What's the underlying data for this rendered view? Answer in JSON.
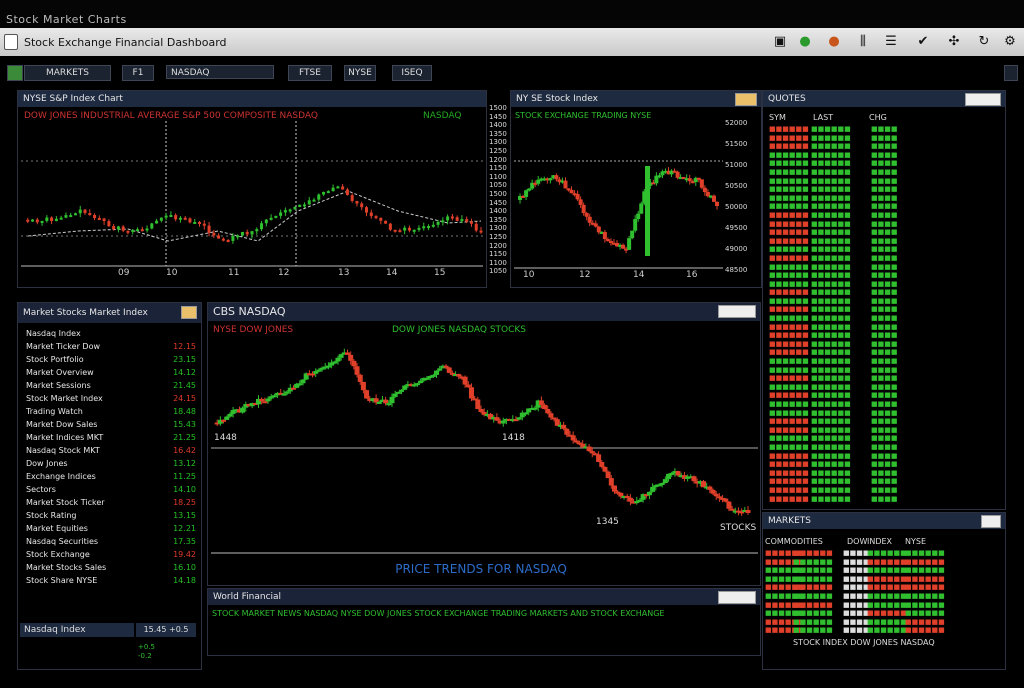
{
  "window": {
    "title": "Stock Market Charts"
  },
  "header": {
    "title": "Stock Exchange Financial Dashboard",
    "icons": [
      "monitor-icon",
      "green-globe-icon",
      "orange-globe-icon",
      "bars-icon",
      "list-icon",
      "check-icon",
      "network-icon",
      "refresh-icon",
      "settings-icon"
    ]
  },
  "toolbar": {
    "items": [
      "MARKETS",
      "F1",
      "NASDAQ",
      "FTSE",
      "NYSE",
      "ISEQ"
    ]
  },
  "panels": {
    "top_left": {
      "title": "NYSE S&P Index Chart",
      "ticker": "DOW JONES INDUSTRIAL AVERAGE  S&P 500 COMPOSITE  NASDAQ",
      "ticker2": "NASDAQ",
      "x_labels": [
        "09",
        "10",
        "11",
        "12",
        "13",
        "14",
        "15"
      ],
      "y_labels": [
        "1500",
        "1450",
        "1400",
        "1350",
        "1300",
        "1250",
        "1200",
        "1150",
        "1100",
        "1050"
      ]
    },
    "top_mid": {
      "title": "NY SE Stock Index",
      "ticker": "STOCK EXCHANGE TRADING NYSE",
      "x_labels": [
        "10",
        "12",
        "14",
        "16"
      ],
      "y_labels": [
        "52000",
        "51500",
        "51000",
        "50500",
        "50000",
        "49500",
        "49000",
        "48500"
      ]
    },
    "right_quotes": {
      "title": "QUOTES",
      "headers": [
        "SYM",
        "LAST",
        "CHG"
      ]
    },
    "watchlist": {
      "title": "Market Stocks Market Index",
      "rows": [
        {
          "name": "Nasdaq Index",
          "val": ""
        },
        {
          "name": "Market Ticker Dow",
          "val": "12.15"
        },
        {
          "name": "Stock Portfolio",
          "val": "23.15"
        },
        {
          "name": "Market Overview",
          "val": "14.12"
        },
        {
          "name": "Market Sessions",
          "val": "21.45"
        },
        {
          "name": "Stock Market Index",
          "val": "24.15"
        },
        {
          "name": "Trading Watch",
          "val": "18.48"
        },
        {
          "name": "Market Dow Sales",
          "val": "15.43"
        },
        {
          "name": "Market Indices MKT",
          "val": "21.25"
        },
        {
          "name": "Nasdaq Stock MKT",
          "val": "16.42"
        },
        {
          "name": "Dow Jones",
          "val": "13.12"
        },
        {
          "name": "Exchange Indices",
          "val": "11.25"
        },
        {
          "name": "Sectors",
          "val": "14.10"
        },
        {
          "name": "Market Stock Ticker",
          "val": "18.25"
        },
        {
          "name": "Stock Rating",
          "val": "13.15"
        },
        {
          "name": "Market Equities",
          "val": "12.21"
        },
        {
          "name": "Nasdaq Securities",
          "val": "17.35"
        },
        {
          "name": "Stock Exchange",
          "val": "19.42"
        },
        {
          "name": "Market Stocks Sales",
          "val": "16.10"
        },
        {
          "name": "Stock Share NYSE",
          "val": "14.18"
        }
      ],
      "footer_left": "Nasdaq Index",
      "footer_right": "15.45 +0.5"
    },
    "main_chart": {
      "title": "CBS NASDAQ",
      "ticker_left": "NYSE DOW JONES",
      "ticker_right": "DOW JONES NASDAQ STOCKS",
      "label_1": "1448",
      "label_2": "1418",
      "label_3": "1345",
      "label_4": "STOCKS",
      "footer": "PRICE TRENDS FOR NASDAQ"
    },
    "news": {
      "title": "World Financial",
      "ticker": "STOCK MARKET NEWS NASDAQ NYSE DOW JONES STOCK EXCHANGE TRADING MARKETS AND STOCK EXCHANGE"
    },
    "bottom_right": {
      "title": "MARKETS",
      "headers": [
        "COMMODITIES",
        "DOW",
        "INDEX",
        "NYSE"
      ],
      "footer": "STOCK INDEX DOW JONES NASDAQ"
    }
  },
  "colors": {
    "up": "#2fbf2f",
    "down": "#e0402a",
    "header": "#1e2a40",
    "accent": "#2d6cc9"
  }
}
